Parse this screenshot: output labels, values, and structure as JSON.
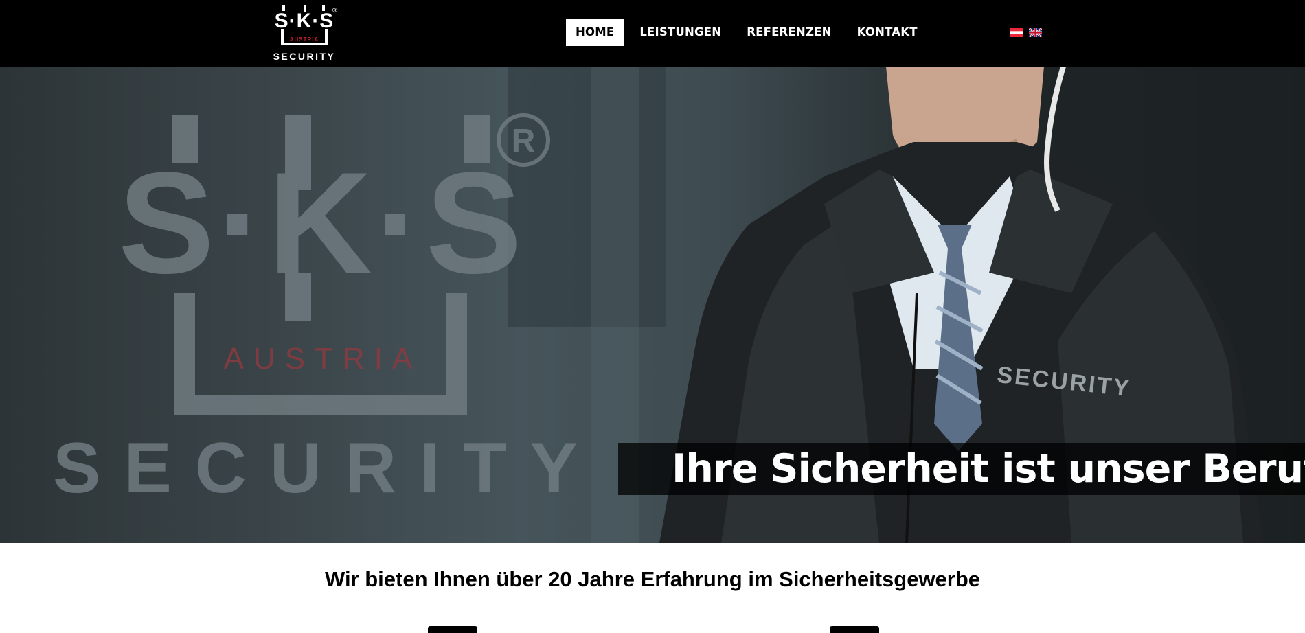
{
  "header": {
    "logo": {
      "text": "S·K·S",
      "sub": "AUSTRIA",
      "word": "SECURITY",
      "reg": "®"
    },
    "nav": [
      {
        "label": "HOME",
        "active": true
      },
      {
        "label": "LEISTUNGEN",
        "active": false
      },
      {
        "label": "REFERENZEN",
        "active": false
      },
      {
        "label": "KONTAKT",
        "active": false
      }
    ],
    "languages": [
      {
        "name": "austria-flag-icon"
      },
      {
        "name": "uk-flag-icon"
      }
    ]
  },
  "hero": {
    "watermark": {
      "text": "S·K·S",
      "sub": "AUSTRIA",
      "word": "SECURITY",
      "reg": "R"
    },
    "jacket_text": "SECURITY",
    "tagline": "Ihre Sicherheit ist unser Beruf!"
  },
  "content": {
    "intro": "Wir bieten Ihnen über 20 Jahre Erfahrung im Sicherheitsgewerbe"
  },
  "colors": {
    "header_bg": "#000000",
    "nav_active_bg": "#ffffff",
    "accent_red": "#c8202f"
  }
}
